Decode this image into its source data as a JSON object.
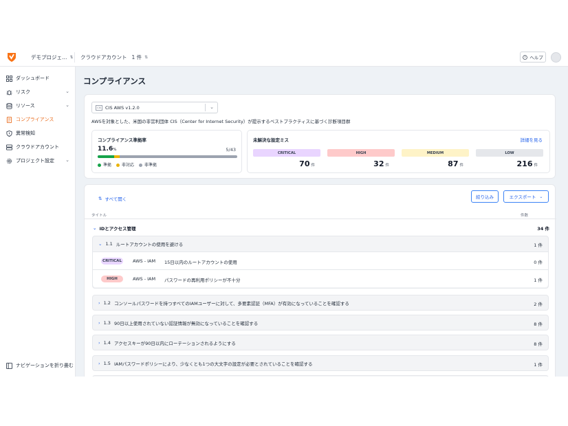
{
  "header": {
    "project": "デモプロジェ…",
    "cloud_account_label": "クラウドアカウント",
    "cloud_account_count": "1 件",
    "help": "ヘルプ"
  },
  "sidebar": {
    "items": [
      {
        "label": "ダッシュボード"
      },
      {
        "label": "リスク"
      },
      {
        "label": "リソース"
      },
      {
        "label": "コンプライアンス"
      },
      {
        "label": "異常検知"
      },
      {
        "label": "クラウドアカウント"
      },
      {
        "label": "プロジェクト設定"
      }
    ],
    "collapse": "ナビゲーションを折り畳む"
  },
  "main": {
    "title": "コンプライアンス",
    "benchmark": {
      "select_value": "CIS AWS v1.2.0",
      "cis_logo_text": "CIS",
      "description": "AWSを対象とした、米国の非営利団体 CIS（Center for Internet Security）が提示するベストプラクティスに基づく診断項目群"
    },
    "rate": {
      "title": "コンプライアンス準拠率",
      "percent": "11.6",
      "percent_unit": "%",
      "ratio": "5/43",
      "compliant_fraction": 0.116,
      "noncompliant_fraction": 0.04,
      "legend": [
        "準拠",
        "非対応",
        "非準拠"
      ],
      "colors": {
        "compliant": "#16a34a",
        "unsupported": "#eab308",
        "noncompliant": "#9ca3af"
      }
    },
    "misconfig": {
      "title": "未解決な設定ミス",
      "details_link": "詳細を見る",
      "unit": "件",
      "levels": [
        {
          "label": "CRITICAL",
          "count": "70",
          "color": "#e9d5ff"
        },
        {
          "label": "HIGH",
          "count": "32",
          "color": "#fecaca"
        },
        {
          "label": "MEDIUM",
          "count": "87",
          "color": "#fef3c7"
        },
        {
          "label": "LOW",
          "count": "216",
          "color": "#e5e7eb"
        }
      ]
    },
    "table": {
      "expand_all": "すべて開く",
      "filter_button": "絞り込み",
      "export_button": "エクスポート",
      "col_title": "タイトル",
      "col_count": "件数",
      "group": {
        "label": "IDとアクセス管理",
        "count": "34 件"
      },
      "sections": [
        {
          "id": "1.1",
          "title": "ルートアカウントの使用を避ける",
          "count": "1 件",
          "items": [
            {
              "severity": "CRITICAL",
              "service": "AWS - IAM",
              "text": "15日以内のルートアカウントの使用",
              "count": "0 件"
            },
            {
              "severity": "HIGH",
              "service": "AWS - IAM",
              "text": "パスワードの再利用ポリシーが不十分",
              "count": "1 件"
            }
          ]
        },
        {
          "id": "1.2",
          "title": "コンソールパスワードを持つすべてのIAMユーザーに対して、多要素認証（MFA）が有効になっていることを確認する",
          "count": "2 件"
        },
        {
          "id": "1.3",
          "title": "90日以上使用されていない認証情報が無効になっていることを確認する",
          "count": "8 件"
        },
        {
          "id": "1.4",
          "title": "アクセスキーが90日以内にローテーションされるようにする",
          "count": "8 件"
        },
        {
          "id": "1.5",
          "title": "IAMパスワードポリシーにより、少なくとも1つの大文字の設定が必要とされていることを確認する",
          "count": "1 件"
        }
      ]
    }
  }
}
